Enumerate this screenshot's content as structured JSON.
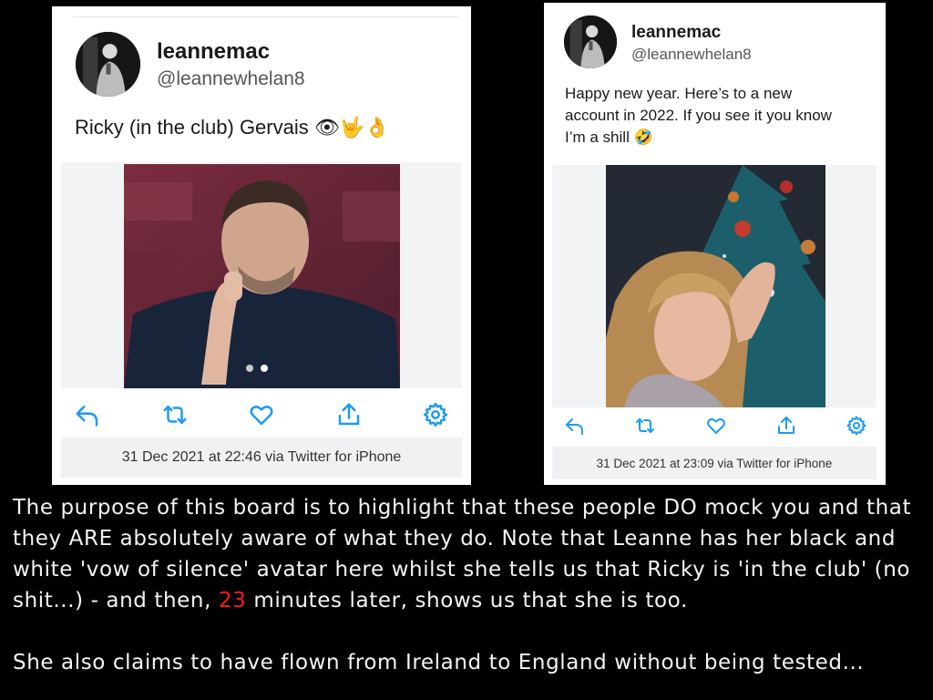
{
  "tweets": [
    {
      "display_name": "leannemac",
      "handle": "@leannewhelan8",
      "text": "Ricky (in the club) Gervais 👁🤟👌",
      "timestamp": "31 Dec 2021 at 22:46 via Twitter for iPhone",
      "media_pages": 2,
      "media_active_page": 2
    },
    {
      "display_name": "leannemac",
      "handle": "@leannewhelan8",
      "text": "Happy new year. Here’s to a new account in 2022. If you see it you know I’m a shill 🤣",
      "timestamp": "31 Dec 2021 at 23:09 via Twitter for iPhone"
    }
  ],
  "actions": [
    "reply-icon",
    "retweet-icon",
    "like-icon",
    "share-icon",
    "settings-icon"
  ],
  "colors": {
    "accent": "#1d9bf0",
    "caption_highlight": "#ff1a1a"
  },
  "caption": {
    "para1_before": "The purpose of this board is to highlight that these people DO mock you and that they ARE absolutely aware of what they do. Note that Leanne has her black and white 'vow of silence' avatar here whilst she tells us that Ricky is 'in the club' (no shit...) - and then, ",
    "para1_highlight": "23",
    "para1_after": " minutes later, shows us that she is too.",
    "para2": "She also claims to have flown from Ireland to England without being tested..."
  }
}
